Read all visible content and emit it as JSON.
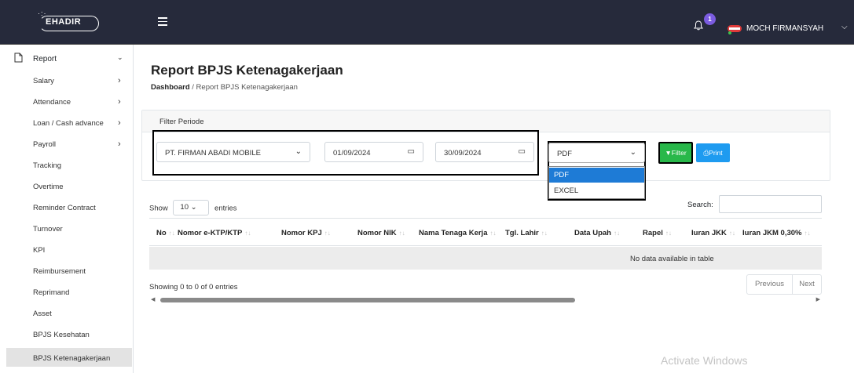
{
  "app": {
    "logo_text": "EHADIR"
  },
  "topbar": {
    "notification_count": "1",
    "user_name": "MOCH FIRMANSYAH"
  },
  "sidebar": {
    "section": "Report",
    "items": [
      {
        "label": "Salary",
        "has_submenu": true
      },
      {
        "label": "Attendance",
        "has_submenu": true
      },
      {
        "label": "Loan / Cash advance",
        "has_submenu": true
      },
      {
        "label": "Payroll",
        "has_submenu": true
      },
      {
        "label": "Tracking",
        "has_submenu": false
      },
      {
        "label": "Overtime",
        "has_submenu": false
      },
      {
        "label": "Reminder Contract",
        "has_submenu": false
      },
      {
        "label": "Turnover",
        "has_submenu": false
      },
      {
        "label": "KPI",
        "has_submenu": false
      },
      {
        "label": "Reimbursement",
        "has_submenu": false
      },
      {
        "label": "Reprimand",
        "has_submenu": false
      },
      {
        "label": "Asset",
        "has_submenu": false
      },
      {
        "label": "BPJS Kesehatan",
        "has_submenu": false
      },
      {
        "label": "BPJS Ketenagakerjaan",
        "has_submenu": false,
        "active": true
      }
    ]
  },
  "page": {
    "title": "Report BPJS Ketenagakerjaan",
    "breadcrumb_home": "Dashboard",
    "breadcrumb_sep": "/",
    "breadcrumb_current": "Report BPJS Ketenagakerjaan"
  },
  "filter": {
    "heading": "Filter Periode",
    "company": "PT. FIRMAN ABADI MOBILE",
    "date_from": "01/09/2024",
    "date_to": "30/09/2024",
    "format": "PDF",
    "format_options": [
      "PDF",
      "EXCEL"
    ],
    "filter_label": "Filter",
    "print_label": "Print"
  },
  "table": {
    "show_label": "Show",
    "entries_value": "10",
    "entries_label": "entries",
    "search_label": "Search:",
    "columns": [
      "No",
      "Nomor e-KTP/KTP",
      "Nomor KPJ",
      "Nomor NIK",
      "Nama Tenaga Kerja",
      "Tgl. Lahir",
      "Data Upah",
      "Rapel",
      "Iuran JKK",
      "Iuran JKM 0,30%"
    ],
    "empty_message": "No data available in table",
    "info": "Showing 0 to 0 of 0 entries",
    "prev_label": "Previous",
    "next_label": "Next"
  },
  "watermark": "Activate Windows",
  "colors": {
    "topbar": "#262a3b",
    "filter_button": "#28b84a",
    "print_button": "#1e9bf0",
    "dropdown_selected": "#1e7bd6",
    "badge": "#7b5ce0"
  }
}
